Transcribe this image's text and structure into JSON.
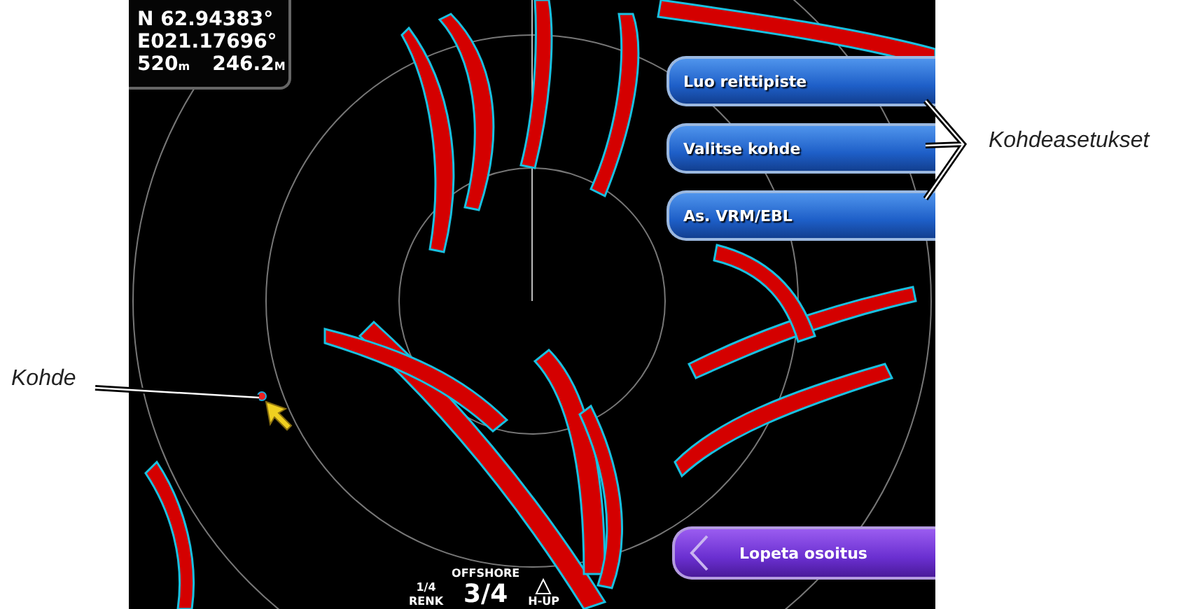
{
  "position": {
    "latitude": "N 62.94383°",
    "longitude": "E021.17696°",
    "depth": {
      "value": "520",
      "unit": "m"
    },
    "distance": {
      "value": "246.2",
      "unit": "M"
    }
  },
  "menu_buttons": [
    {
      "label": "Luo reittipiste",
      "kind": "option"
    },
    {
      "label": "Valitse kohde",
      "kind": "option"
    },
    {
      "label": "As. VRM/EBL",
      "kind": "option"
    },
    {
      "label": "Lopeta osoitus",
      "kind": "back"
    }
  ],
  "range_bar": {
    "gain": "1/4",
    "gain_label": "RENK",
    "mode": "OFFSHORE",
    "range": "3/4",
    "orientation": "H-UP"
  },
  "callouts": {
    "target": "Kohde",
    "target_settings": "Kohdeasetukset"
  }
}
